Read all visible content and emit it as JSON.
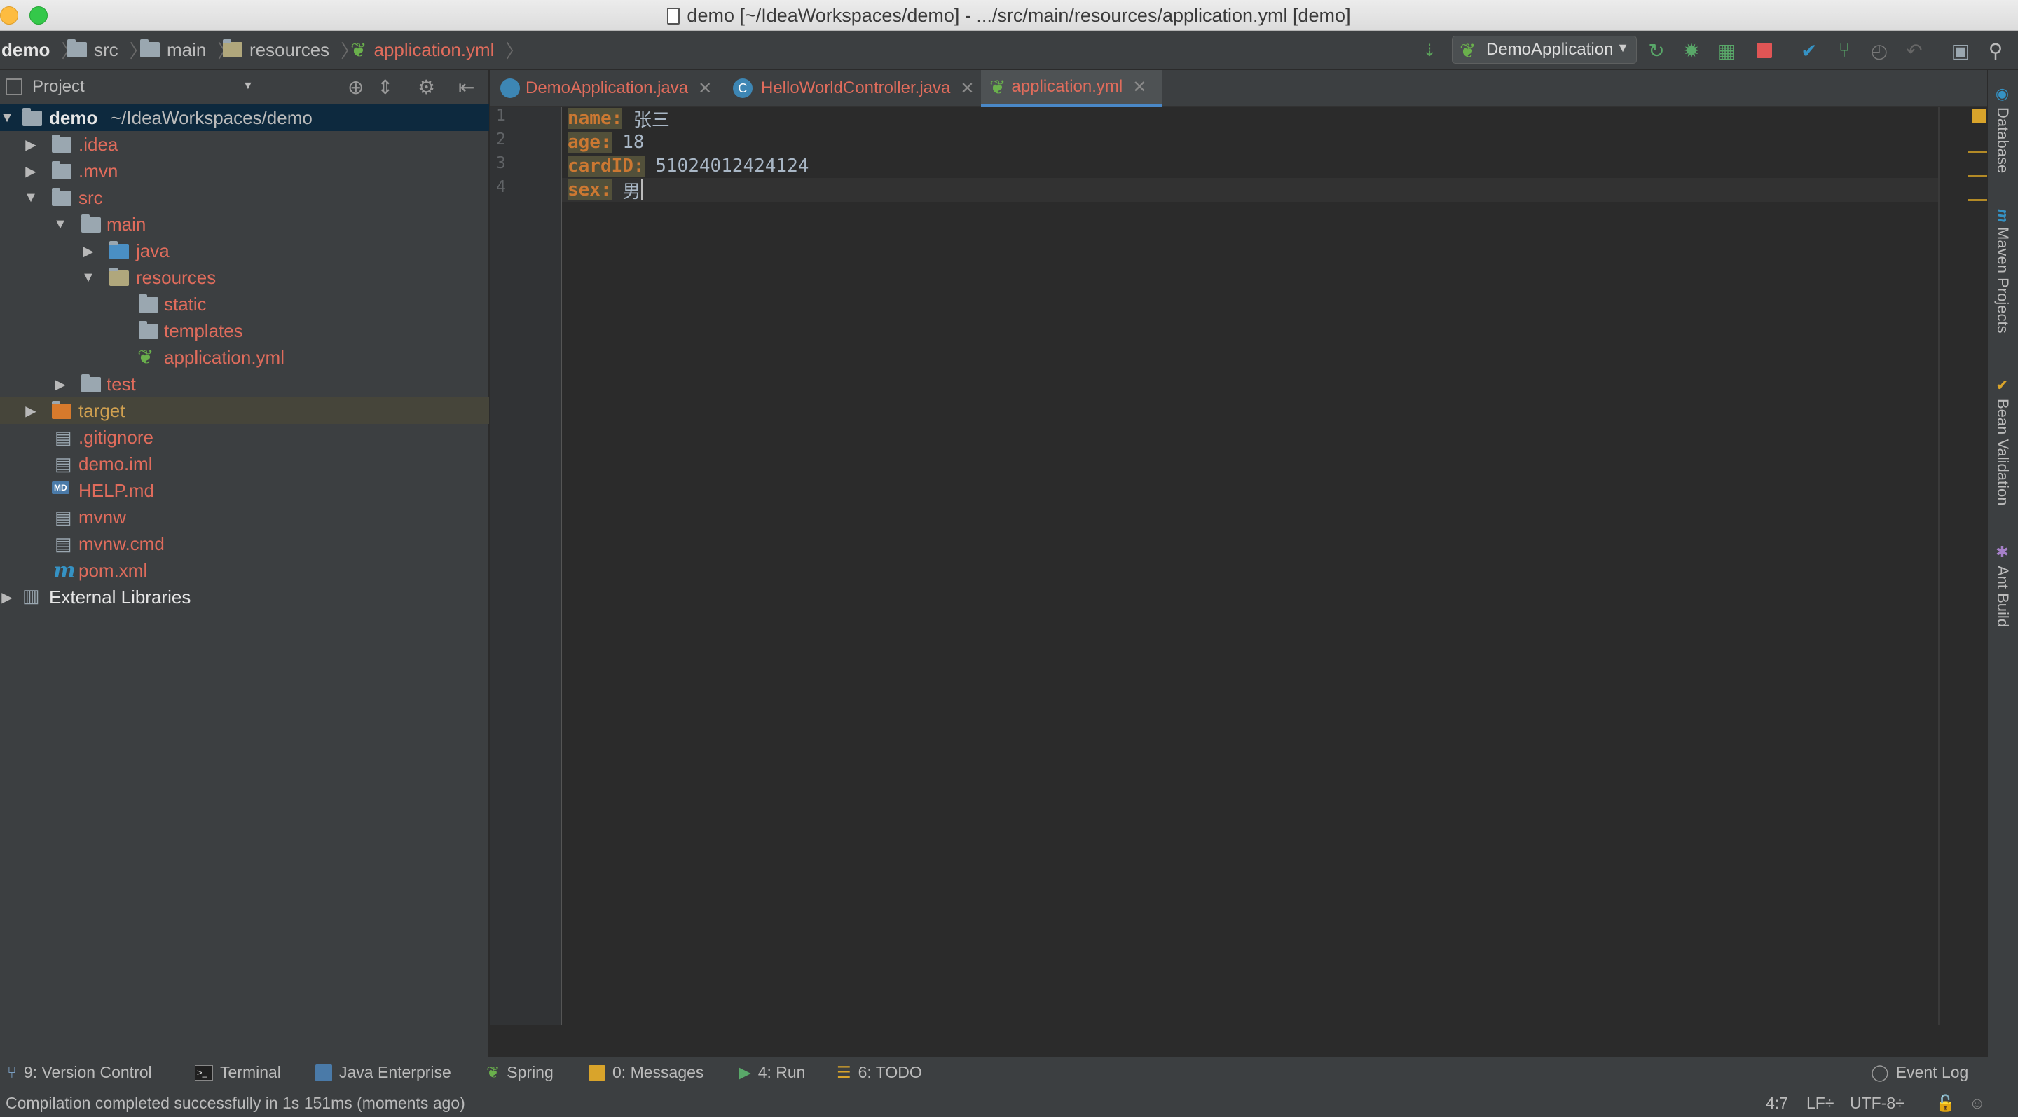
{
  "window": {
    "title": "demo [~/IdeaWorkspaces/demo] - .../src/main/resources/application.yml [demo]",
    "close_color": "#fc605c",
    "minimize_color": "#fdbc40",
    "zoom_color": "#34c84a"
  },
  "breadcrumbs": {
    "items": [
      "demo",
      "src",
      "main",
      "resources",
      "application.yml"
    ]
  },
  "toolbar": {
    "run_config": "DemoApplication",
    "icons": [
      "vcs-update-icon",
      "spring-run-config-icon",
      "run-icon",
      "debug-icon",
      "coverage-icon",
      "stop-icon",
      "vcs-commit-icon",
      "vcs-branch-icon",
      "vcs-history-icon",
      "undo-icon",
      "project-structure-icon",
      "search-icon"
    ]
  },
  "project_panel": {
    "title": "Project",
    "tree": [
      {
        "label": "demo",
        "suffix": "~/IdeaWorkspaces/demo"
      },
      {
        "label": ".idea"
      },
      {
        "label": ".mvn"
      },
      {
        "label": "src"
      },
      {
        "label": "main"
      },
      {
        "label": "java"
      },
      {
        "label": "resources"
      },
      {
        "label": "static"
      },
      {
        "label": "templates"
      },
      {
        "label": "application.yml"
      },
      {
        "label": "test"
      },
      {
        "label": "target"
      },
      {
        "label": ".gitignore"
      },
      {
        "label": "demo.iml"
      },
      {
        "label": "HELP.md"
      },
      {
        "label": "mvnw"
      },
      {
        "label": "mvnw.cmd"
      },
      {
        "label": "pom.xml"
      },
      {
        "label": "External Libraries"
      }
    ]
  },
  "editor": {
    "tabs": [
      {
        "label": "DemoApplication.java"
      },
      {
        "label": "HelloWorldController.java"
      },
      {
        "label": "application.yml"
      }
    ],
    "active_tab": "application.yml",
    "lines": [
      {
        "number": "1",
        "key": "name:",
        "value": " 张三"
      },
      {
        "number": "2",
        "key": "age:",
        "value": " 18"
      },
      {
        "number": "3",
        "key": "cardID:",
        "value": " 51024012424124"
      },
      {
        "number": "4",
        "key": "sex:",
        "value": " 男"
      }
    ]
  },
  "right_tool_windows": [
    "Database",
    "Maven Projects",
    "Bean Validation",
    "Ant Build"
  ],
  "bottom_tool_windows": [
    {
      "label": "9: Version Control"
    },
    {
      "label": "Terminal"
    },
    {
      "label": "Java Enterprise"
    },
    {
      "label": "Spring"
    },
    {
      "label": "0: Messages"
    },
    {
      "label": "4: Run"
    },
    {
      "label": "6: TODO"
    },
    {
      "label": "Event Log"
    }
  ],
  "status_bar": {
    "message": "Compilation completed successfully in 1s 151ms (moments ago)",
    "position": "4:7",
    "line_separator": "LF÷",
    "encoding": "UTF-8÷"
  },
  "colors": {
    "key": "#cc7832",
    "modified_file": "#e06c5c",
    "excluded_folder": "#d0a050",
    "spring_green": "#6ab04c"
  }
}
